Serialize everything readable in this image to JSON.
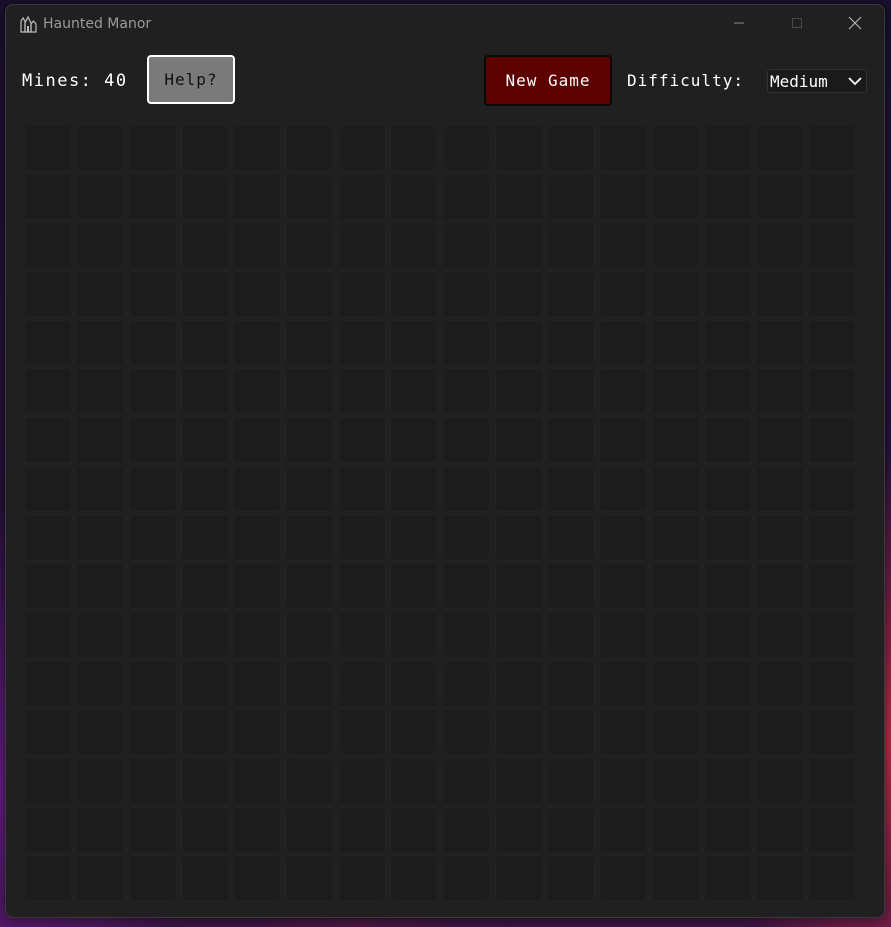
{
  "window": {
    "title": "Haunted Manor",
    "icon": "haunted-manor-icon",
    "controls": [
      "minimize-icon",
      "maximize-icon",
      "close-icon"
    ]
  },
  "toolbar": {
    "mines_label": "Mines: 40",
    "help_label": "Help?",
    "new_game_label": "New Game",
    "difficulty_label": "Difficulty:",
    "difficulty_value": "Medium"
  },
  "board": {
    "rows": 16,
    "columns": 16,
    "state": "all-covered"
  },
  "colors": {
    "window_bg": "#202020",
    "cell_bg": "#1c1c1c",
    "help_button_bg": "#7a7a7a",
    "new_game_button_bg": "#5c0000",
    "text": "#ffffff"
  }
}
